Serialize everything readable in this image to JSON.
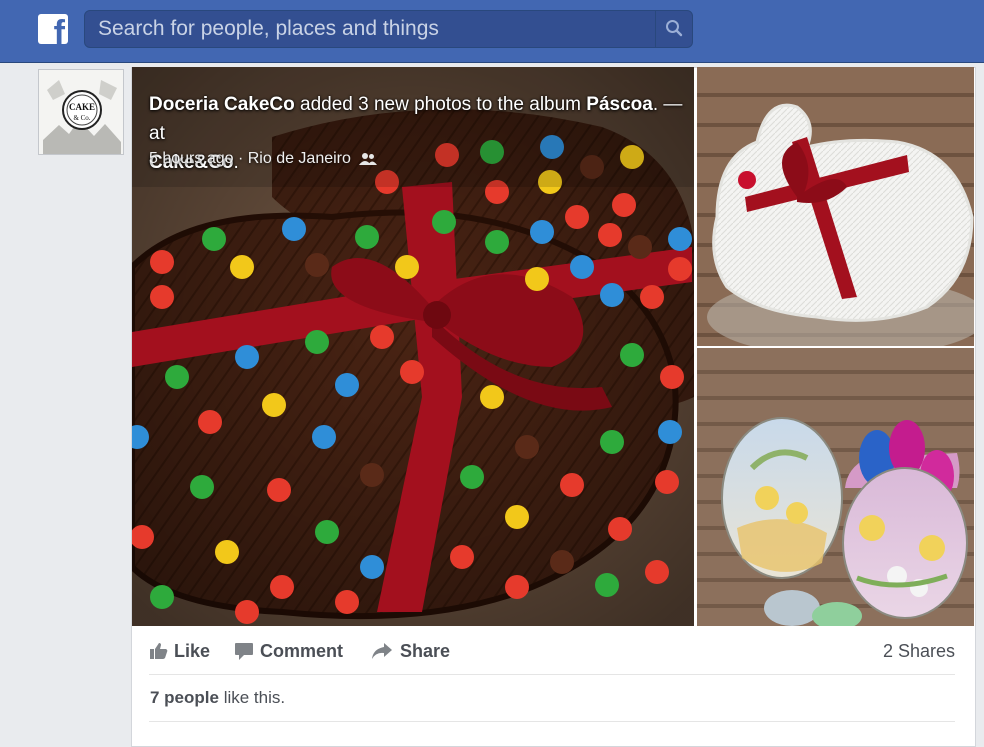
{
  "topbar": {
    "logo_letter": "f",
    "search_placeholder": "Search for people, places and things"
  },
  "post": {
    "author": "Doceria CakeCo",
    "action_text": " added 3 new photos to the album ",
    "album": "Páscoa",
    "at_text": ". — at",
    "place": "Cake&Co",
    "place_suffix": ".",
    "time": "5 hours ago",
    "location_sep": " · ",
    "location": "Rio de Janeiro",
    "avatar_text": "CAKE & Co"
  },
  "actions": {
    "like": "Like",
    "comment": "Comment",
    "share": "Share",
    "shares_count": "2 Shares"
  },
  "likes": {
    "count_text": "7 people",
    "suffix": " like this."
  },
  "colors": {
    "brand_blue": "#4267b2",
    "chocolate": "#4a2414",
    "ribbon": "#a3101e"
  },
  "icons": [
    "facebook-logo-icon",
    "search-icon",
    "audience-icon",
    "like-icon",
    "comment-icon",
    "share-icon"
  ]
}
